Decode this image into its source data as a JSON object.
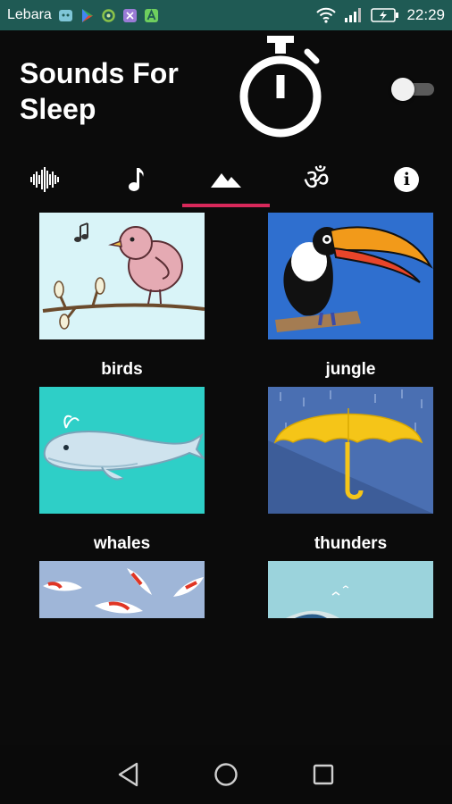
{
  "status_bar": {
    "carrier": "Lebara",
    "time": "22:29",
    "icons": [
      "notification-icon",
      "play-store-icon",
      "recycle-icon",
      "app-icon",
      "android-icon",
      "wifi-icon",
      "signal-icon",
      "battery-charging-icon"
    ]
  },
  "header": {
    "title": "Sounds For Sleep",
    "timer_icon": "stopwatch-icon",
    "toggle_state": "off"
  },
  "tabs": [
    {
      "icon": "waveform-icon",
      "active": false
    },
    {
      "icon": "music-note-icon",
      "active": false
    },
    {
      "icon": "mountains-icon",
      "active": true
    },
    {
      "icon": "om-icon",
      "active": false
    },
    {
      "icon": "info-icon",
      "active": false
    }
  ],
  "tab_glyphs": {
    "om": "ॐ",
    "info": "i"
  },
  "sounds": [
    {
      "label": "birds",
      "image": "bird-on-branch"
    },
    {
      "label": "jungle",
      "image": "toucan"
    },
    {
      "label": "whales",
      "image": "whale"
    },
    {
      "label": "thunders",
      "image": "umbrella-in-rain"
    },
    {
      "label": "",
      "image": "koi-fish"
    },
    {
      "label": "",
      "image": "seascape"
    }
  ],
  "colors": {
    "status_bar": "#1f5a54",
    "background": "#0b0b0b",
    "tab_indicator": "#d8285a",
    "text": "#ffffff"
  }
}
